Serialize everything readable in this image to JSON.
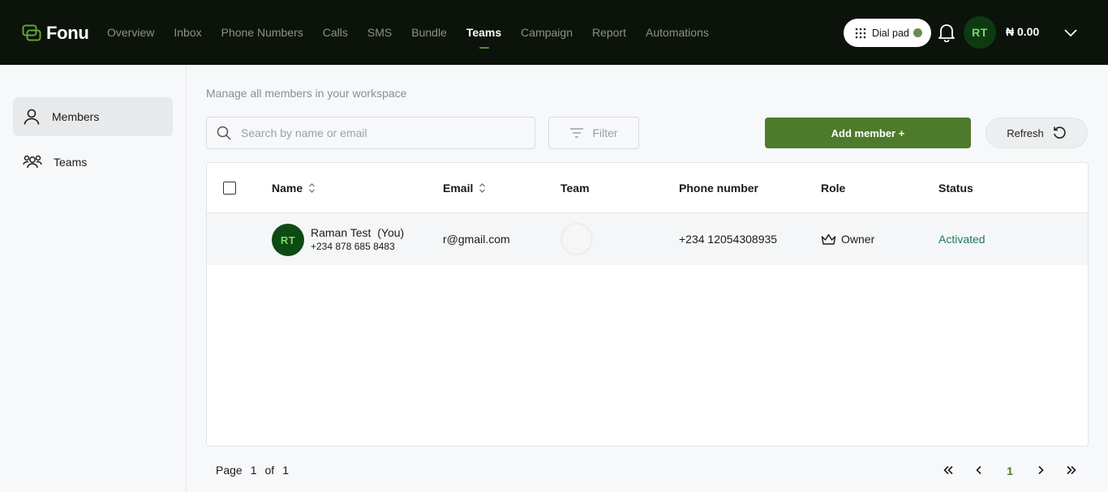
{
  "brand": {
    "name": "Fonu",
    "logo_icon": "fonu-logo-icon"
  },
  "nav": {
    "items": [
      "Overview",
      "Inbox",
      "Phone Numbers",
      "Calls",
      "SMS",
      "Bundle",
      "Teams",
      "Campaign",
      "Report",
      "Automations"
    ],
    "active": "Teams"
  },
  "header": {
    "dialpad_label": "Dial pad",
    "avatar_initials": "RT",
    "balance": "₦ 0.00"
  },
  "sidebar": {
    "items": [
      {
        "label": "Members",
        "icon": "user-icon",
        "active": true
      },
      {
        "label": "Teams",
        "icon": "users-group-icon",
        "active": false
      }
    ]
  },
  "main": {
    "subtitle": "Manage all members in your workspace",
    "search_placeholder": "Search by name or email",
    "filter_label": "Filter",
    "add_member_label": "Add member +",
    "refresh_label": "Refresh"
  },
  "table": {
    "columns": [
      "Name",
      "Email",
      "Team",
      "Phone number",
      "Role",
      "Status"
    ],
    "rows": [
      {
        "initials": "RT",
        "name": "Raman Test  (You)",
        "sub_phone": "+234 878 685 8483",
        "email": "r@gmail.com",
        "team": "",
        "phone": "+234 12054308935",
        "role": "Owner",
        "status": "Activated"
      }
    ]
  },
  "pagination": {
    "page_label": "Page",
    "current": "1",
    "of_label": "of",
    "total": "1",
    "first": "«",
    "prev": "‹",
    "next": "›",
    "last": "»"
  },
  "colors": {
    "topbar": "#0c130a",
    "accent": "#4e7a2c",
    "status_active": "#1f7a5e"
  }
}
